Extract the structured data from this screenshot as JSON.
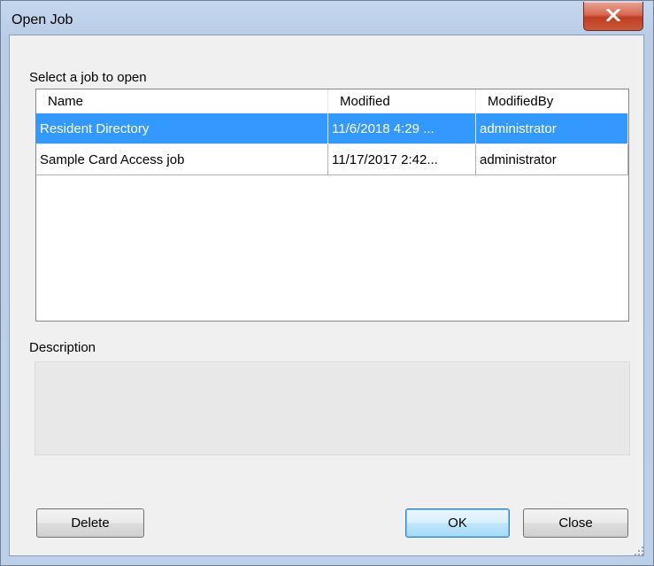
{
  "window": {
    "title": "Open Job"
  },
  "list": {
    "label": "Select a job to open",
    "columns": [
      "Name",
      "Modified",
      "ModifiedBy"
    ],
    "rows": [
      {
        "name": "Resident Directory",
        "modified": "11/6/2018 4:29 ...",
        "modified_by": "administrator",
        "selected": true
      },
      {
        "name": "Sample Card Access job",
        "modified": "11/17/2017 2:42...",
        "modified_by": "administrator",
        "selected": false
      }
    ]
  },
  "description": {
    "label": "Description",
    "value": ""
  },
  "buttons": {
    "delete": "Delete",
    "ok": "OK",
    "close": "Close"
  },
  "icons": {
    "close": "close-icon",
    "grip": "resize-grip-icon"
  },
  "colors": {
    "selection": "#3399ff",
    "close_button": "#c13d22"
  }
}
